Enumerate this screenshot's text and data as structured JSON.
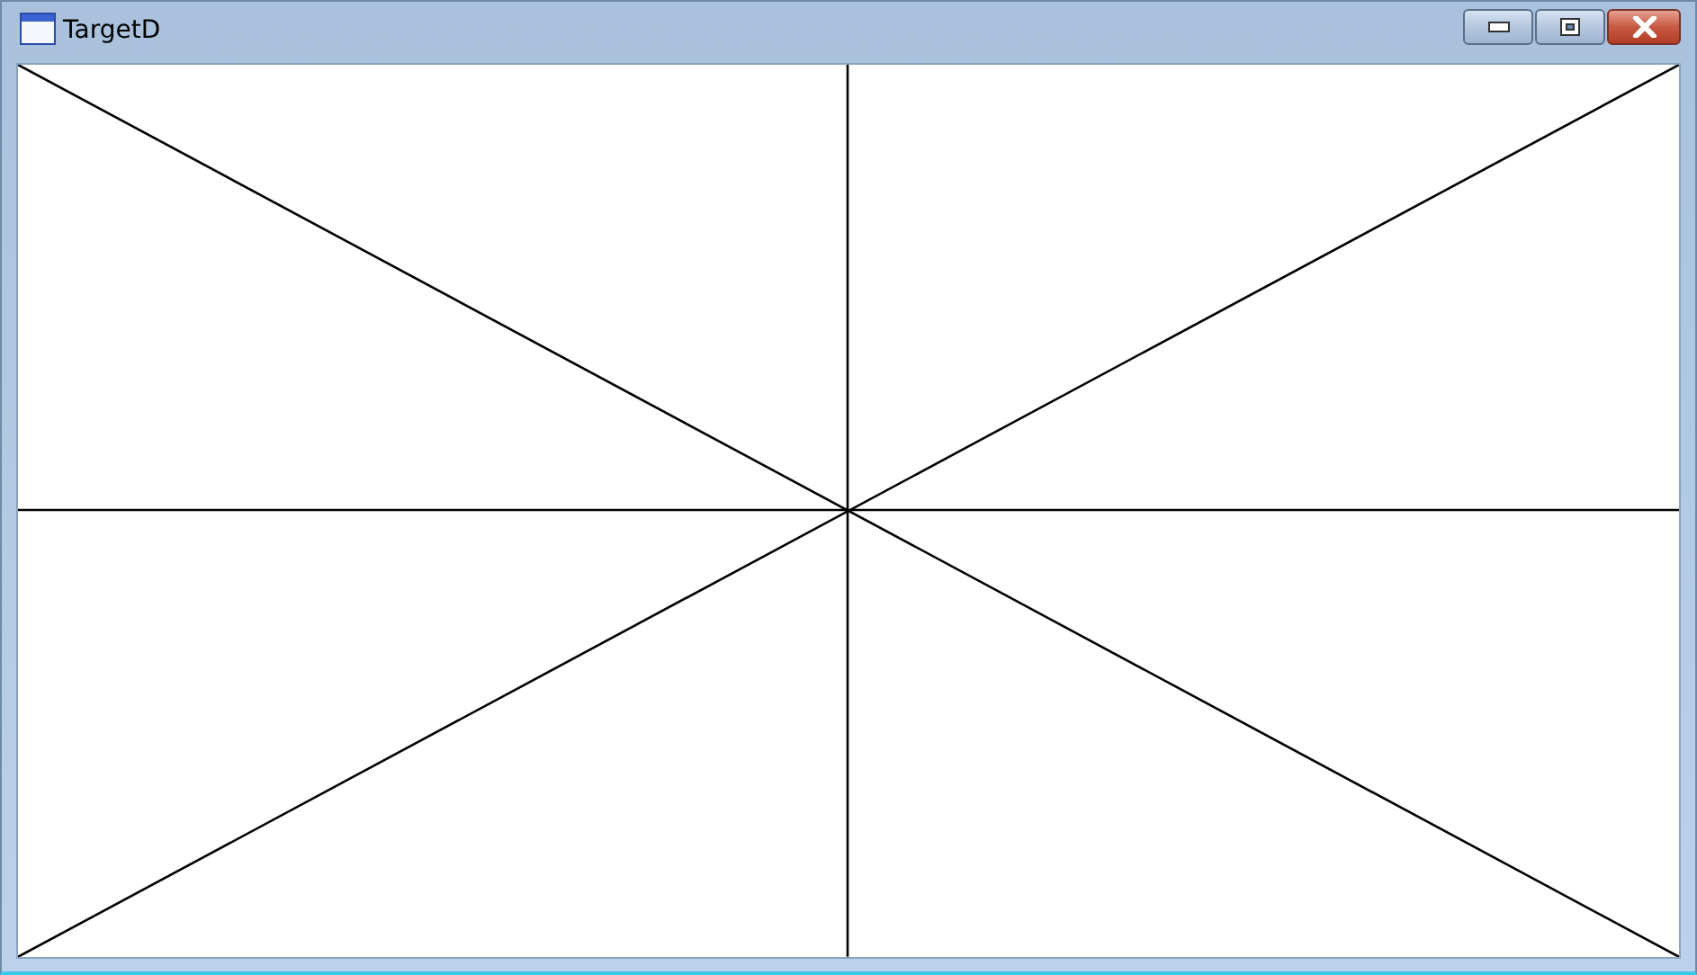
{
  "window": {
    "title": "TargetD"
  }
}
